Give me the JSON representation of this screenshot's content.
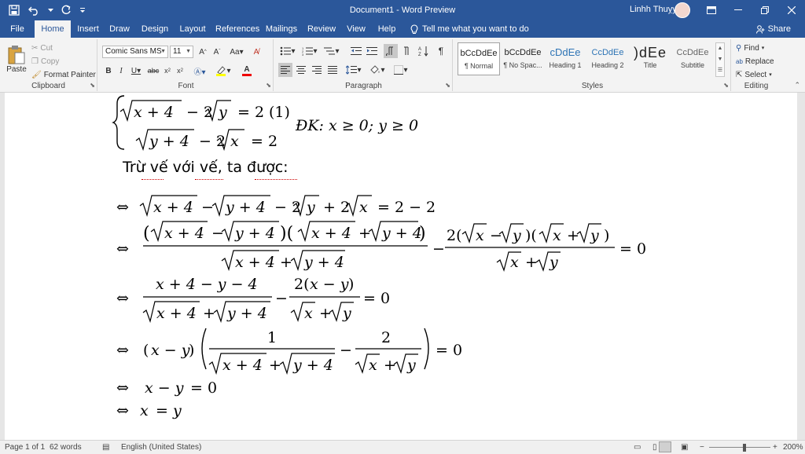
{
  "window": {
    "title": "Document1  -  Word Preview",
    "user": "Linhh Thuỵy"
  },
  "tabs": [
    "File",
    "Home",
    "Insert",
    "Draw",
    "Design",
    "Layout",
    "References",
    "Mailings",
    "Review",
    "View",
    "Help"
  ],
  "tell_me": "Tell me what you want to do",
  "share": "Share",
  "ribbon": {
    "clipboard": {
      "label": "Clipboard",
      "paste": "Paste",
      "cut": "Cut",
      "copy": "Copy",
      "format_painter": "Format Painter"
    },
    "font": {
      "label": "Font",
      "font_name": "Comic Sans MS",
      "font_size": "11"
    },
    "paragraph": {
      "label": "Paragraph"
    },
    "styles": {
      "label": "Styles",
      "items": [
        {
          "preview": "bCcDdEe",
          "name": "¶ Normal"
        },
        {
          "preview": "bCcDdEe",
          "name": "¶ No Spac..."
        },
        {
          "preview": "cDdEe",
          "name": "Heading 1"
        },
        {
          "preview": "CcDdEe",
          "name": "Heading 2"
        },
        {
          "preview": ")dEe",
          "name": "Title"
        },
        {
          "preview": "CcDdEe",
          "name": "Subtitle"
        }
      ]
    },
    "editing": {
      "label": "Editing",
      "find": "Find",
      "replace": "Replace",
      "select": "Select"
    }
  },
  "document": {
    "system_condition": "ĐK: x ≥ 0; y ≥ 0",
    "system_label": "(1)",
    "text_line": "Trừ vế với vế, ta được:"
  },
  "status": {
    "page": "Page 1 of 1",
    "words": "62 words",
    "language": "English (United States)",
    "zoom": "200%"
  },
  "colors": {
    "accent": "#2b579a"
  }
}
